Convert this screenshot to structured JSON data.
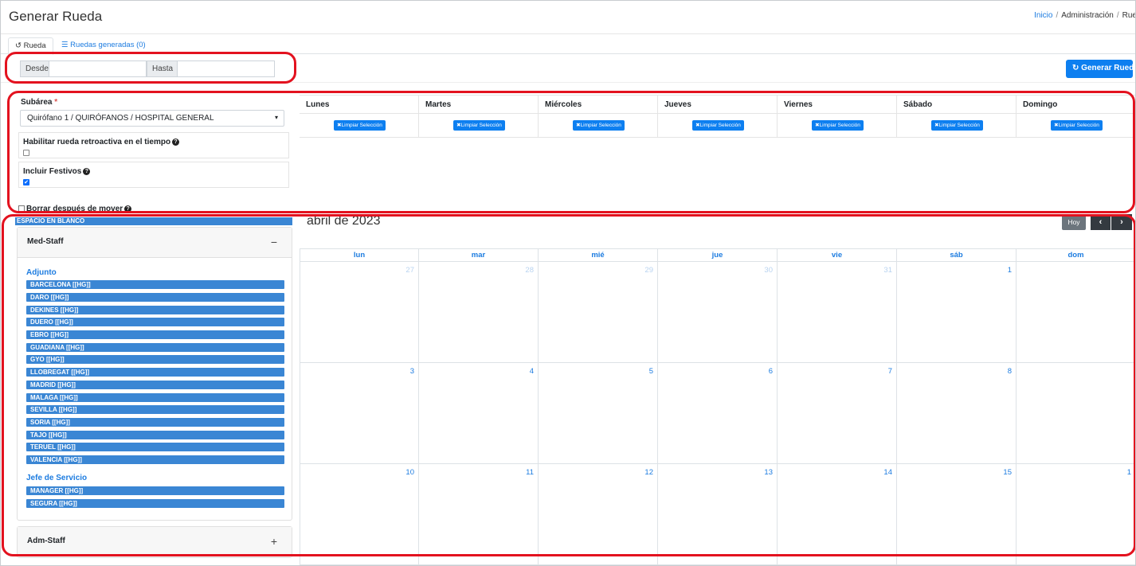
{
  "header": {
    "title": "Generar Rueda",
    "breadcrumb": {
      "home": "Inicio",
      "admin": "Administración",
      "current": "Rue"
    }
  },
  "tabs": [
    {
      "label": "Rueda",
      "icon": "history-icon"
    },
    {
      "label": "Ruedas generadas (0)",
      "icon": "list-icon"
    }
  ],
  "date_range": {
    "from_label": "Desde",
    "from_value": "",
    "to_label": "Hasta",
    "to_value": ""
  },
  "generate_button": "Generar Rueda",
  "settings": {
    "subarea_label": "Subárea",
    "subarea_required": "*",
    "subarea_value": "Quirófano 1 / QUIRÓFANOS / HOSPITAL GENERAL",
    "retro_label": "Habilitar rueda retroactiva en el tiempo",
    "retro_checked": false,
    "festivos_label": "Incluir Festivos",
    "festivos_checked": true
  },
  "week_days": [
    "Lunes",
    "Martes",
    "Miércoles",
    "Jueves",
    "Viernes",
    "Sábado",
    "Domingo"
  ],
  "clear_label": "Limpiar Selección",
  "borrar_label": "Borrar después de mover",
  "blank_label": "ESPACIO EN BLANCO",
  "staff": {
    "med_title": "Med-Staff",
    "med_toggle": "−",
    "groups": [
      {
        "title": "Adjunto",
        "people": [
          "BARCELONA [[HG]]",
          "DARO [[HG]]",
          "DEKINES [[HG]]",
          "DUERO [[HG]]",
          "EBRO [[HG]]",
          "GUADIANA [[HG]]",
          "GYO [[HG]]",
          "LLOBREGAT [[HG]]",
          "MADRID [[HG]]",
          "MALAGA [[HG]]",
          "SEVILLA [[HG]]",
          "SORIA [[HG]]",
          "TAJO [[HG]]",
          "TERUEL [[HG]]",
          "VALENCIA [[HG]]"
        ]
      },
      {
        "title": "Jefe de Servicio",
        "people": [
          "MANAGER [[HG]]",
          "SEGURA [[HG]]"
        ]
      }
    ],
    "adm_title": "Adm-Staff",
    "adm_toggle": "+"
  },
  "calendar": {
    "title": "abril de 2023",
    "today_label": "Hoy",
    "prev_label": "‹",
    "next_label": "›",
    "dow": [
      "lun",
      "mar",
      "mié",
      "jue",
      "vie",
      "sáb",
      "dom"
    ],
    "weeks": [
      [
        {
          "n": "27",
          "m": true
        },
        {
          "n": "28",
          "m": true
        },
        {
          "n": "29",
          "m": true
        },
        {
          "n": "30",
          "m": true
        },
        {
          "n": "31",
          "m": true
        },
        {
          "n": "1",
          "m": false
        },
        {
          "n": "",
          "m": false
        }
      ],
      [
        {
          "n": "3",
          "m": false
        },
        {
          "n": "4",
          "m": false
        },
        {
          "n": "5",
          "m": false
        },
        {
          "n": "6",
          "m": false
        },
        {
          "n": "7",
          "m": false
        },
        {
          "n": "8",
          "m": false
        },
        {
          "n": "",
          "m": false
        }
      ],
      [
        {
          "n": "10",
          "m": false
        },
        {
          "n": "11",
          "m": false
        },
        {
          "n": "12",
          "m": false
        },
        {
          "n": "13",
          "m": false
        },
        {
          "n": "14",
          "m": false
        },
        {
          "n": "15",
          "m": false
        },
        {
          "n": "1",
          "m": false
        }
      ]
    ]
  }
}
